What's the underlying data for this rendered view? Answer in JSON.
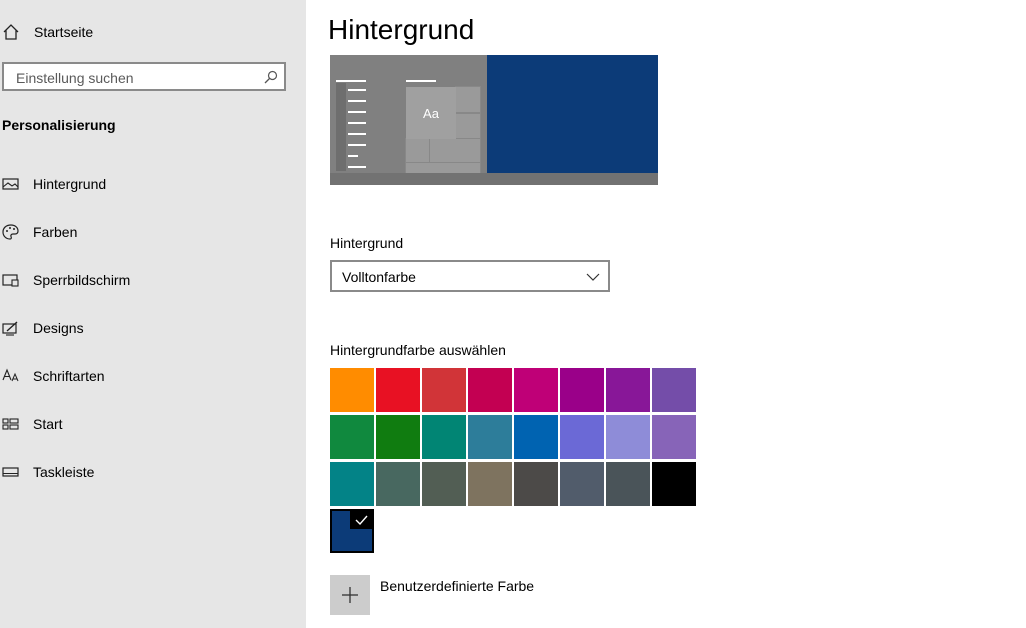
{
  "sidebar": {
    "home_label": "Startseite",
    "search_placeholder": "Einstellung suchen",
    "section_title": "Personalisierung",
    "items": [
      {
        "label": "Hintergrund",
        "icon": "picture-icon"
      },
      {
        "label": "Farben",
        "icon": "palette-icon"
      },
      {
        "label": "Sperrbildschirm",
        "icon": "lock-screen-icon"
      },
      {
        "label": "Designs",
        "icon": "designs-icon"
      },
      {
        "label": "Schriftarten",
        "icon": "fonts-icon"
      },
      {
        "label": "Start",
        "icon": "start-icon"
      },
      {
        "label": "Taskleiste",
        "icon": "taskbar-icon"
      }
    ]
  },
  "main": {
    "title": "Hintergrund",
    "preview": {
      "sample_text": "Aa",
      "background_color": "#0c3b78"
    },
    "background_field": {
      "label": "Hintergrund",
      "value": "Volltonfarbe"
    },
    "color_picker": {
      "label": "Hintergrundfarbe auswählen",
      "colors": [
        "#ff8c00",
        "#e81123",
        "#d13438",
        "#c30052",
        "#bf0077",
        "#9a0089",
        "#881798",
        "#744da9",
        "#10893e",
        "#107c10",
        "#018574",
        "#2d7d9a",
        "#0063b1",
        "#6b69d6",
        "#8e8cd8",
        "#8764b8",
        "#038387",
        "#486860",
        "#525e54",
        "#7e735f",
        "#4c4a48",
        "#515c6b",
        "#4a5459",
        "#000000",
        "#0c3b78"
      ],
      "selected_index": 24
    },
    "custom_color_label": "Benutzerdefinierte Farbe"
  }
}
